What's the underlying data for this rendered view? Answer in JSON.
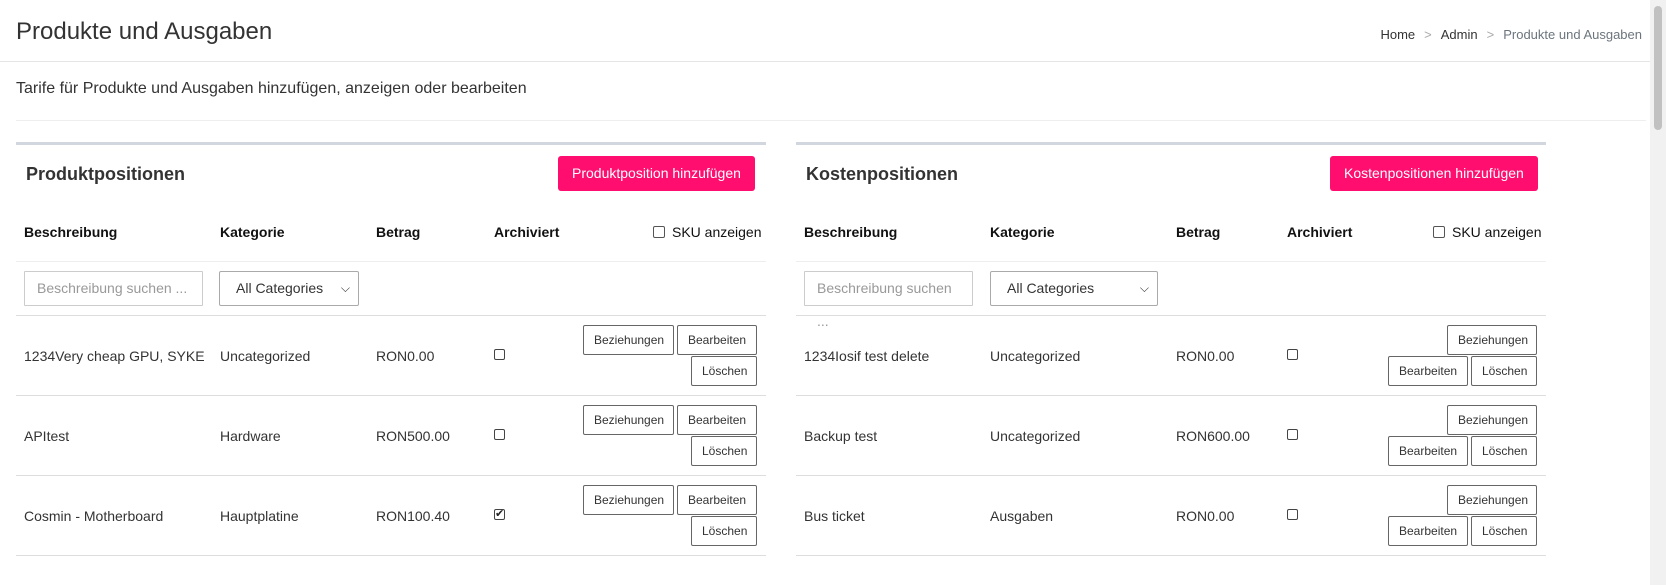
{
  "page": {
    "title": "Produkte und Ausgaben",
    "subtitle": "Tarife für Produkte und Ausgaben hinzufügen, anzeigen oder bearbeiten"
  },
  "breadcrumb": {
    "home": "Home",
    "admin": "Admin",
    "current": "Produkte und Ausgaben",
    "separator": ">"
  },
  "products": {
    "title": "Produktpositionen",
    "add_label": "Produktposition hinzufügen",
    "columns": {
      "description": "Beschreibung",
      "category": "Kategorie",
      "amount": "Betrag",
      "archived": "Archiviert"
    },
    "sku_label": "SKU anzeigen",
    "search_placeholder": "Beschreibung suchen ...",
    "category_filter": "All Categories",
    "rows": [
      {
        "description": "1234Very cheap GPU, SYKE",
        "category": "Uncategorized",
        "amount": "RON0.00",
        "archived": false
      },
      {
        "description": "APItest",
        "category": "Hardware",
        "amount": "RON500.00",
        "archived": false
      },
      {
        "description": "Cosmin - Motherboard",
        "category": "Hauptplatine",
        "amount": "RON100.40",
        "archived": true
      }
    ]
  },
  "expenses": {
    "title": "Kostenpositionen",
    "add_label": "Kostenpositionen hinzufügen",
    "columns": {
      "description": "Beschreibung",
      "category": "Kategorie",
      "amount": "Betrag",
      "archived": "Archiviert"
    },
    "sku_label": "SKU anzeigen",
    "search_placeholder": "Beschreibung suchen ...",
    "category_filter": "All Categories",
    "rows": [
      {
        "description": "1234Iosif test delete",
        "category": "Uncategorized",
        "amount": "RON0.00",
        "archived": false
      },
      {
        "description": "Backup test",
        "category": "Uncategorized",
        "amount": "RON600.00",
        "archived": false
      },
      {
        "description": "Bus ticket",
        "category": "Ausgaben",
        "amount": "RON0.00",
        "archived": false
      }
    ]
  },
  "actions": {
    "relations": "Beziehungen",
    "edit": "Bearbeiten",
    "delete": "Löschen"
  },
  "icons": {
    "checkmark": "✔",
    "dropdown": "chevron-down-icon"
  },
  "colors": {
    "accent": "#ff0d6f",
    "panel_border": "#d2d6de"
  }
}
